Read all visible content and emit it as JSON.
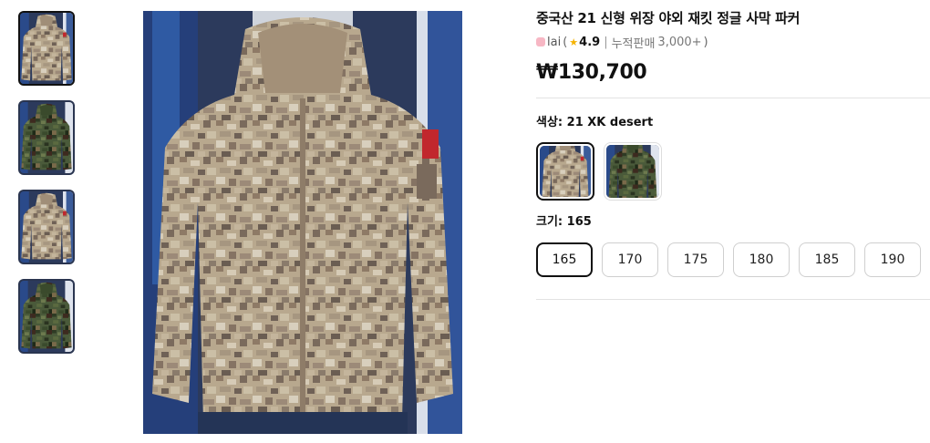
{
  "product": {
    "title": "중국산 21 신형 위장 야외 재킷 정글 사막 파커",
    "seller": "lai",
    "rating": "4.9",
    "sales_label": "누적판매",
    "sales_count": "3,000+",
    "price": "₩130,700"
  },
  "options": {
    "color_label": "색상: 21 XK desert",
    "size_label": "크기: 165",
    "sizes": [
      "165",
      "170",
      "175",
      "180",
      "185",
      "190"
    ],
    "selected_size": "165",
    "selected_color_index": 0
  },
  "gallery": {
    "thumbnails": [
      {
        "variant": "desert",
        "active": true
      },
      {
        "variant": "jungle",
        "active": false
      },
      {
        "variant": "desert",
        "active": false
      },
      {
        "variant": "jungle",
        "active": false
      }
    ]
  },
  "colors": {
    "rating_star": "#f5b301",
    "border_active": "#111111",
    "border_inactive": "#cfcfcf"
  }
}
